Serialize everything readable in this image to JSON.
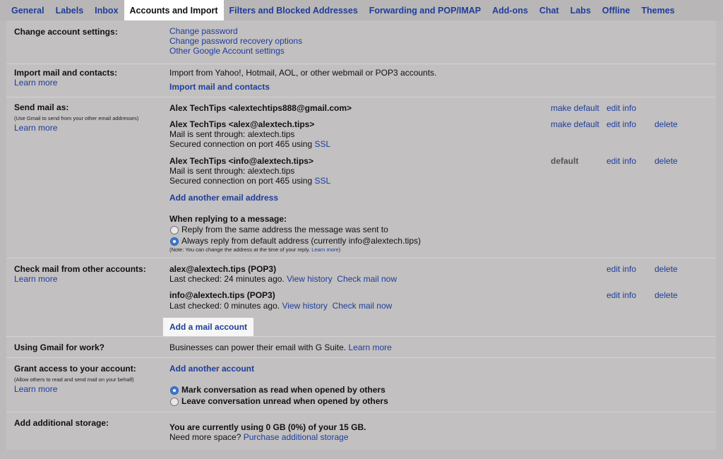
{
  "tabs": [
    "General",
    "Labels",
    "Inbox",
    "Accounts and Import",
    "Filters and Blocked Addresses",
    "Forwarding and POP/IMAP",
    "Add-ons",
    "Chat",
    "Labs",
    "Offline",
    "Themes"
  ],
  "change_account": {
    "label": "Change account settings:",
    "links": [
      "Change password",
      "Change password recovery options",
      "Other Google Account settings"
    ]
  },
  "import_mail": {
    "label": "Import mail and contacts:",
    "learn_more": "Learn more",
    "description": "Import from Yahoo!, Hotmail, AOL, or other webmail or POP3 accounts.",
    "action": "Import mail and contacts"
  },
  "send_mail": {
    "label": "Send mail as:",
    "note": "(Use Gmail to send from your other email addresses)",
    "learn_more": "Learn more",
    "accounts": [
      {
        "address": "Alex TechTips <alextechtips888@gmail.com>",
        "status": "make default",
        "edit": "edit info",
        "delete": ""
      },
      {
        "address": "Alex TechTips <alex@alextech.tips>",
        "line1": "Mail is sent through: alextech.tips",
        "line2": "Secured connection on port 465 using",
        "ssl": "SSL",
        "status": "make default",
        "edit": "edit info",
        "delete": "delete"
      },
      {
        "address": "Alex TechTips <info@alextech.tips>",
        "line1": "Mail is sent through: alextech.tips",
        "line2": "Secured connection on port 465 using",
        "ssl": "SSL",
        "status": "default",
        "edit": "edit info",
        "delete": "delete"
      }
    ],
    "add_address": "Add another email address",
    "reply_heading": "When replying to a message:",
    "reply_options": [
      "Reply from the same address the message was sent to",
      "Always reply from default address (currently info@alextech.tips)"
    ],
    "reply_selected": 1,
    "reply_note": "(Note: You can change the address at the time of your reply.",
    "reply_note_link": "Learn more",
    "reply_note_end": ")"
  },
  "check_mail": {
    "label": "Check mail from other accounts:",
    "learn_more": "Learn more",
    "accounts": [
      {
        "address": "alex@alextech.tips (POP3)",
        "checked": "Last checked: 24 minutes ago.",
        "history": "View history",
        "check": "Check mail now",
        "edit": "edit info",
        "delete": "delete"
      },
      {
        "address": "info@alextech.tips (POP3)",
        "checked": "Last checked: 0 minutes ago.",
        "history": "View history",
        "check": "Check mail now",
        "edit": "edit info",
        "delete": "delete"
      }
    ],
    "add_account": "Add a mail account"
  },
  "work": {
    "label": "Using Gmail for work?",
    "text": "Businesses can power their email with G Suite.",
    "learn_more": "Learn more"
  },
  "grant": {
    "label": "Grant access to your account:",
    "note": "(Allow others to read and send mail on your behalf)",
    "learn_more": "Learn more",
    "add_account": "Add another account",
    "options": [
      "Mark conversation as read when opened by others",
      "Leave conversation unread when opened by others"
    ],
    "selected": 0
  },
  "storage": {
    "label": "Add additional storage:",
    "usage": "You are currently using 0 GB (0%) of your 15 GB.",
    "need": "Need more space?",
    "purchase": "Purchase additional storage"
  }
}
